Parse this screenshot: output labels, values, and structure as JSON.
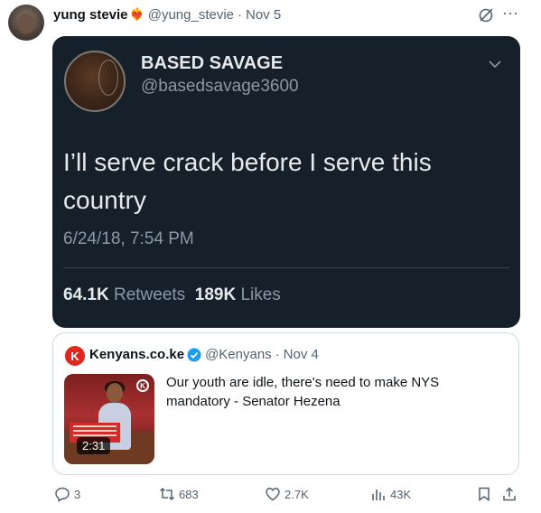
{
  "tweet": {
    "author_name": "yung stevie",
    "author_emoji": "❤️‍🔥",
    "handle": "@yung_stevie",
    "separator": "·",
    "date": "Nov 5",
    "more": "···"
  },
  "screenshot": {
    "name": "BASED SAVAGE",
    "handle": "@basedsavage3600",
    "text": "I’ll serve crack before I serve this country",
    "timestamp": "6/24/18, 7:54 PM",
    "retweets_count": "64.1K",
    "retweets_label": "Retweets",
    "likes_count": "189K",
    "likes_label": "Likes"
  },
  "quote": {
    "logo_letter": "K",
    "name": "Kenyans.co.ke",
    "handle": "@Kenyans",
    "separator": "·",
    "date": "Nov 4",
    "text": "Our youth are idle, there's need to make NYS mandatory - Senator Hezena",
    "video_duration": "2:31"
  },
  "actions": {
    "replies": "3",
    "reposts": "683",
    "likes": "2.7K",
    "views": "43K"
  },
  "colors": {
    "accent": "#1d9bf0",
    "dark_card": "#15202b",
    "brand_red": "#e1261c"
  }
}
